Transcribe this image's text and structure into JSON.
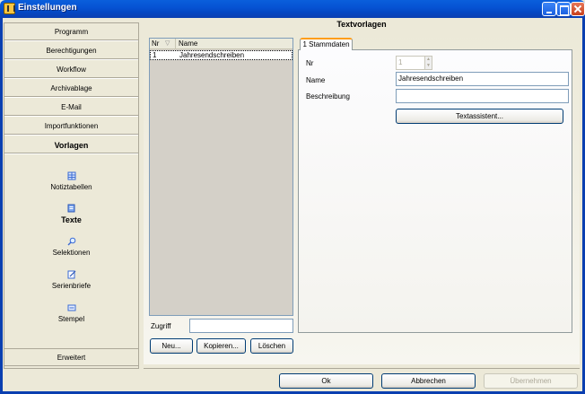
{
  "window": {
    "title": "Einstellungen"
  },
  "nav": {
    "items": [
      {
        "label": "Programm"
      },
      {
        "label": "Berechtigungen"
      },
      {
        "label": "Workflow"
      },
      {
        "label": "Archivablage"
      },
      {
        "label": "E-Mail"
      },
      {
        "label": "Importfunktionen"
      },
      {
        "label": "Vorlagen"
      }
    ],
    "subitems": [
      {
        "label": "Notiztabellen",
        "icon": "table-icon"
      },
      {
        "label": "Texte",
        "icon": "document-icon"
      },
      {
        "label": "Selektionen",
        "icon": "magnifier-icon"
      },
      {
        "label": "Serienbriefe",
        "icon": "letter-icon"
      },
      {
        "label": "Stempel",
        "icon": "stamp-icon"
      }
    ],
    "bottom_label": "Erweitert"
  },
  "header": {
    "title": "Textvorlagen"
  },
  "list": {
    "columns": [
      "Nr",
      "Name"
    ],
    "rows": [
      {
        "nr": "1",
        "name": "Jahresendschreiben"
      }
    ]
  },
  "zugriff": {
    "label": "Zugriff",
    "value": ""
  },
  "list_buttons": {
    "new": "Neu...",
    "copy": "Kopieren...",
    "delete": "Löschen"
  },
  "tab": {
    "label": "1 Stammdaten"
  },
  "form": {
    "nr_label": "Nr",
    "nr_value": "1",
    "name_label": "Name",
    "name_value": "Jahresendschreiben",
    "desc_label": "Beschreibung",
    "desc_value": "",
    "assistant_button": "Textassistent..."
  },
  "footer": {
    "ok": "Ok",
    "cancel": "Abbrechen",
    "apply": "Übernehmen"
  }
}
